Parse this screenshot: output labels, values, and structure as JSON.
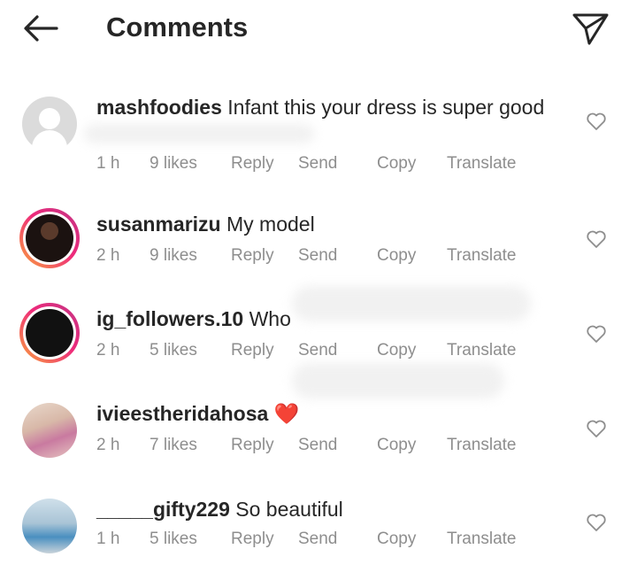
{
  "header": {
    "title": "Comments",
    "back_icon": "arrow-left-icon",
    "send_icon": "paper-plane-icon"
  },
  "actions": {
    "reply": "Reply",
    "send": "Send",
    "copy": "Copy",
    "translate": "Translate"
  },
  "comments": [
    {
      "username": "mashfoodies",
      "text": "Infant this your dress is super good",
      "time": "1 h",
      "likes": "9 likes",
      "avatar": "default-avatar",
      "ring": false
    },
    {
      "username": "susanmarizu",
      "text": "My model",
      "time": "2 h",
      "likes": "9 likes",
      "avatar": "photo-avatar",
      "ring": true
    },
    {
      "username": "ig_followers.10",
      "text": "Who",
      "time": "2 h",
      "likes": "5 likes",
      "avatar": "dark-avatar",
      "ring": true
    },
    {
      "username": "ivieestheridahosa",
      "text": "❤️",
      "time": "2 h",
      "likes": "7 likes",
      "avatar": "photo-avatar",
      "ring": false
    },
    {
      "username": "_____gifty229",
      "text": "So beautiful",
      "time": "1 h",
      "likes": "5 likes",
      "avatar": "photo-avatar",
      "ring": false
    }
  ],
  "colors": {
    "text": "#262626",
    "meta": "#8e8e8e",
    "ring_start": "#f9a33c",
    "ring_end": "#c13584",
    "heart": "#ed4956"
  }
}
